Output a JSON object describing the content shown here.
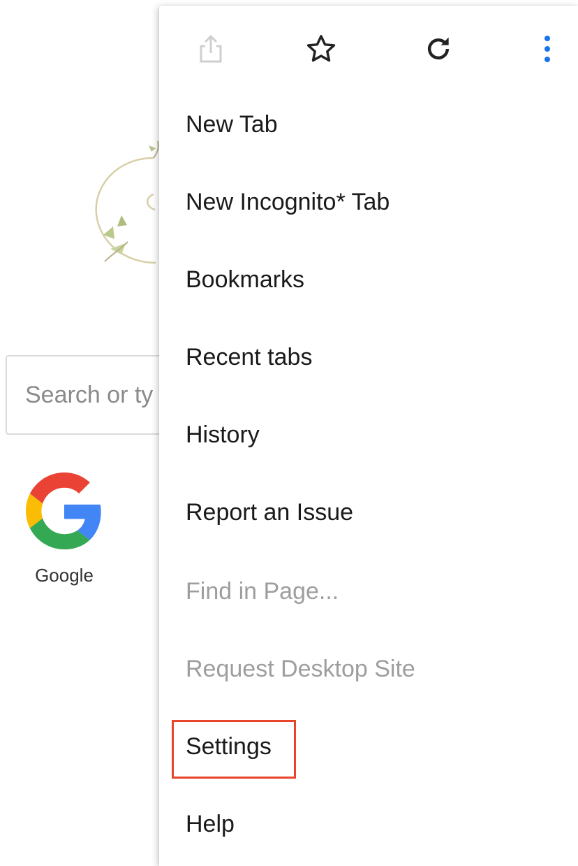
{
  "background": {
    "search": {
      "placeholder": "Search or ty"
    },
    "shortcuts": [
      {
        "label": "Google",
        "icon": "google-logo-icon"
      }
    ]
  },
  "menu": {
    "toolbar": [
      {
        "icon": "share-icon",
        "enabled": false
      },
      {
        "icon": "star-icon",
        "enabled": true
      },
      {
        "icon": "reload-icon",
        "enabled": true
      },
      {
        "icon": "more-vert-icon",
        "enabled": true
      }
    ],
    "items": [
      {
        "label": "New Tab",
        "enabled": true
      },
      {
        "label": "New Incognito* Tab",
        "enabled": true
      },
      {
        "label": "Bookmarks",
        "enabled": true
      },
      {
        "label": "Recent tabs",
        "enabled": true
      },
      {
        "label": "History",
        "enabled": true
      },
      {
        "label": "Report an Issue",
        "enabled": true
      },
      {
        "label": "Find in Page...",
        "enabled": false
      },
      {
        "label": "Request Desktop Site",
        "enabled": false
      },
      {
        "label": "Settings",
        "enabled": true,
        "highlighted": true
      },
      {
        "label": "Help",
        "enabled": true
      }
    ]
  },
  "colors": {
    "highlight": "#e8452a",
    "more_icon": "#1a73e8",
    "disabled_text": "#9e9e9e"
  }
}
